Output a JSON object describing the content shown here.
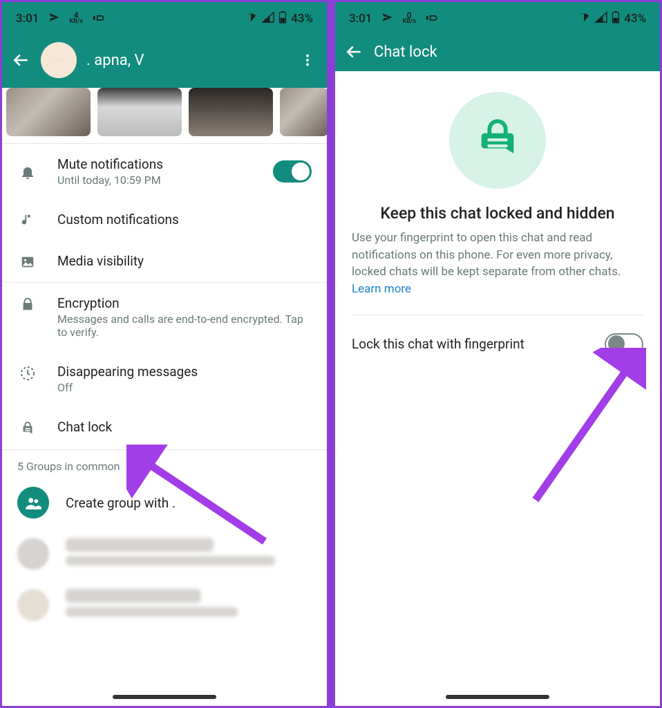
{
  "status": {
    "time": "3:01",
    "kb_value": "4",
    "kb_unit": "KB/s",
    "kb_value_b": "0",
    "battery": "43%"
  },
  "left": {
    "title": ". apna, V",
    "mute": {
      "title": "Mute notifications",
      "sub": "Until today, 10:59 PM"
    },
    "custom": "Custom notifications",
    "media": "Media visibility",
    "encryption": {
      "title": "Encryption",
      "sub": "Messages and calls are end-to-end encrypted. Tap to verify."
    },
    "disappearing": {
      "title": "Disappearing messages",
      "sub": "Off"
    },
    "chatlock": "Chat lock",
    "groups_header": "5 Groups in common",
    "create_group": "Create group with ."
  },
  "right": {
    "title": "Chat lock",
    "hero": "Keep this chat locked and hidden",
    "desc": "Use your fingerprint to open this chat and read notifications on this phone. For even more privacy, locked chats will be kept separate from other chats. ",
    "learn": "Learn more",
    "toggle_label": "Lock this chat with fingerprint"
  }
}
